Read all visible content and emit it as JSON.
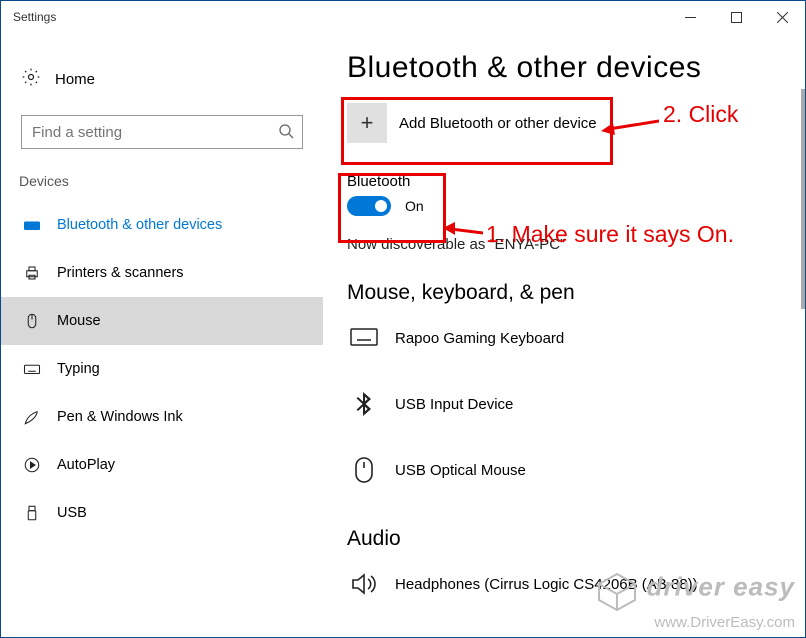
{
  "titlebar": {
    "title": "Settings"
  },
  "sidebar": {
    "home_label": "Home",
    "search_placeholder": "Find a setting",
    "section_label": "Devices",
    "items": [
      {
        "label": "Bluetooth & other devices"
      },
      {
        "label": "Printers & scanners"
      },
      {
        "label": "Mouse"
      },
      {
        "label": "Typing"
      },
      {
        "label": "Pen & Windows Ink"
      },
      {
        "label": "AutoPlay"
      },
      {
        "label": "USB"
      }
    ]
  },
  "main": {
    "title": "Bluetooth & other devices",
    "add_label": "Add Bluetooth or other device",
    "bt_label": "Bluetooth",
    "bt_state": "On",
    "discoverable": "Now discoverable as “ENYA-PC”",
    "group1_title": "Mouse, keyboard, & pen",
    "devices1": [
      {
        "label": "Rapoo Gaming Keyboard"
      },
      {
        "label": "USB Input Device"
      },
      {
        "label": "USB Optical Mouse"
      }
    ],
    "group2_title": "Audio",
    "devices2": [
      {
        "label": "Headphones (Cirrus Logic CS4206B (AB 88))"
      }
    ]
  },
  "annotations": {
    "step1": "1. Make sure it says On.",
    "step2": "2. Click"
  },
  "watermark": {
    "line1": "driver easy",
    "line2": "www.DriverEasy.com"
  }
}
